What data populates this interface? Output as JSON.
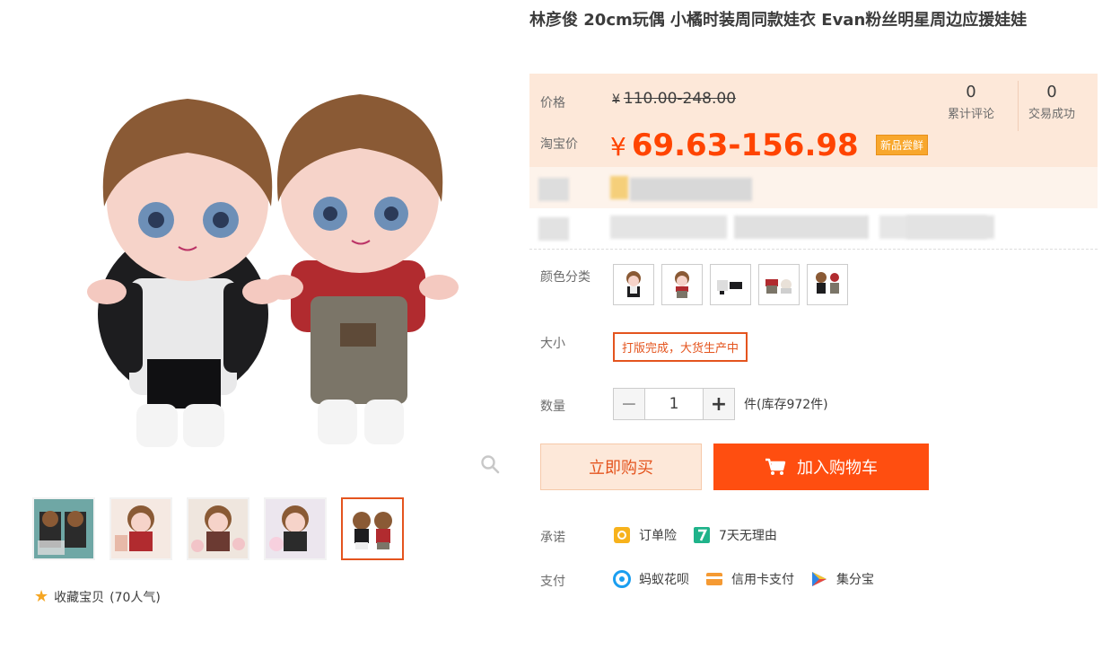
{
  "product": {
    "title": "林彦俊 20cm玩偶 小橘时装周同款娃衣 Evan粉丝明星周边应援娃娃"
  },
  "price": {
    "label": "价格",
    "original": "110.00-248.00",
    "currency_symbol": "¥",
    "taobao_label": "淘宝价",
    "taobao_price": "69.63-156.98",
    "badge": "新品尝鲜"
  },
  "stats": [
    {
      "value": "0",
      "label": "累计评论"
    },
    {
      "value": "0",
      "label": "交易成功"
    }
  ],
  "options": {
    "color_label": "颜色分类",
    "size_label": "大小",
    "size_value": "打版完成，大货生产中",
    "quantity_label": "数量",
    "quantity_value": "1",
    "stock_text": "件(库存972件)"
  },
  "buttons": {
    "buy_now": "立即购买",
    "add_to_cart": "加入购物车"
  },
  "promise": {
    "label": "承诺",
    "items": [
      "订单险",
      "7天无理由"
    ]
  },
  "payment": {
    "label": "支付",
    "items": [
      "蚂蚁花呗",
      "信用卡支付",
      "集分宝"
    ]
  },
  "favorite": {
    "label": "收藏宝贝",
    "count": "(70人气)"
  },
  "colors": {
    "accent": "#ff4e10",
    "price": "#ff4400",
    "price_bg": "#fde8d9",
    "selected_border": "#e4541e"
  }
}
